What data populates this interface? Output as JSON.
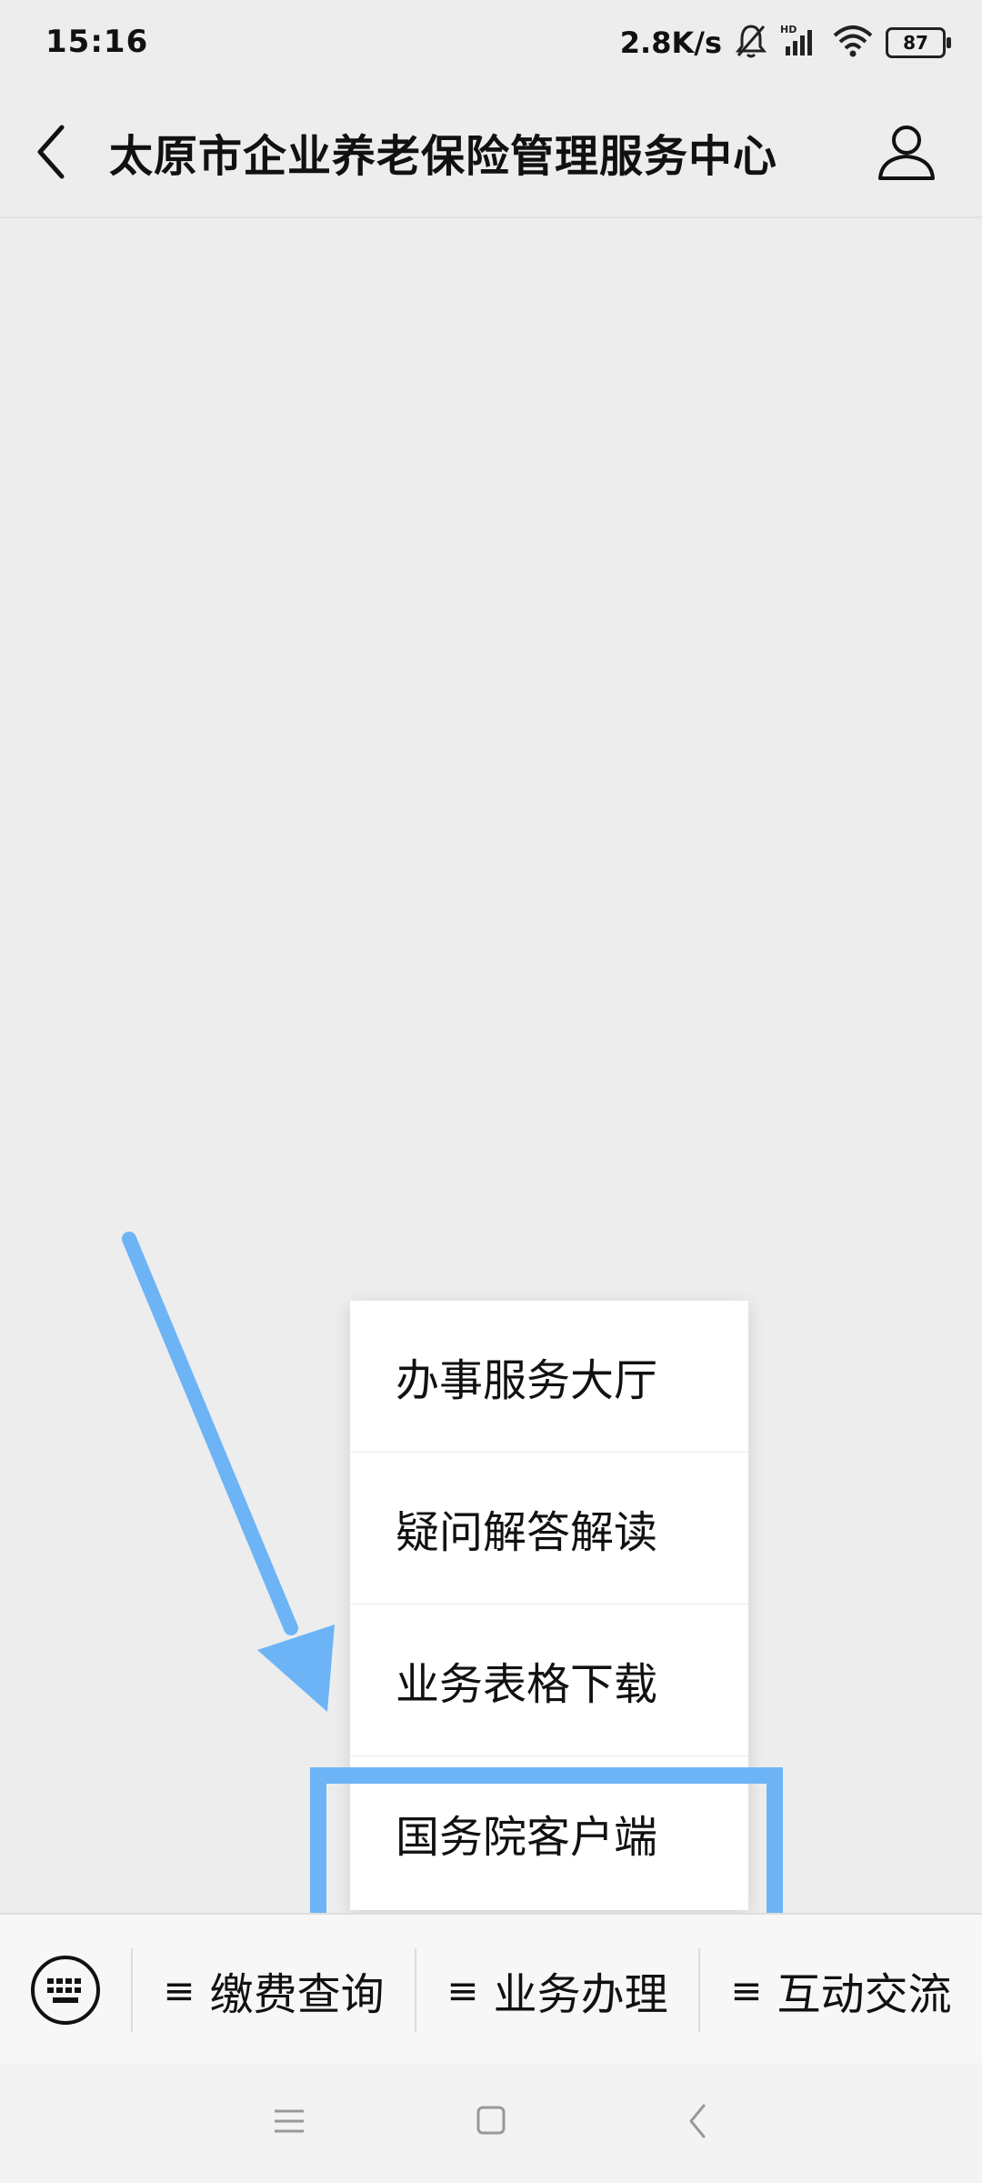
{
  "status_bar": {
    "time": "15:16",
    "net_speed": "2.8K/s",
    "battery": "87",
    "icons": [
      "mute-bell-icon",
      "signal-hd-icon",
      "wifi-icon",
      "battery-icon"
    ]
  },
  "header": {
    "title": "太原市企业养老保险管理服务中心",
    "back_icon": "back-chevron-icon",
    "profile_icon": "profile-icon"
  },
  "popup_menu": {
    "items": [
      {
        "label": "办事服务大厅"
      },
      {
        "label": "疑问解答解读"
      },
      {
        "label": "业务表格下载"
      },
      {
        "label": "国务院客户端"
      }
    ],
    "highlighted_index": 3
  },
  "annotation": {
    "highlight_color": "#6db4f7",
    "arrow_color": "#6db4f7"
  },
  "bottom_menu": {
    "keyboard_icon": "keyboard-icon",
    "tabs": [
      {
        "label": "缴费查询"
      },
      {
        "label": "业务办理"
      },
      {
        "label": "互动交流"
      }
    ],
    "menu_marker": "≡"
  },
  "system_nav": {
    "icons": [
      "menu-lines-icon",
      "home-square-icon",
      "back-arrow-icon"
    ]
  }
}
